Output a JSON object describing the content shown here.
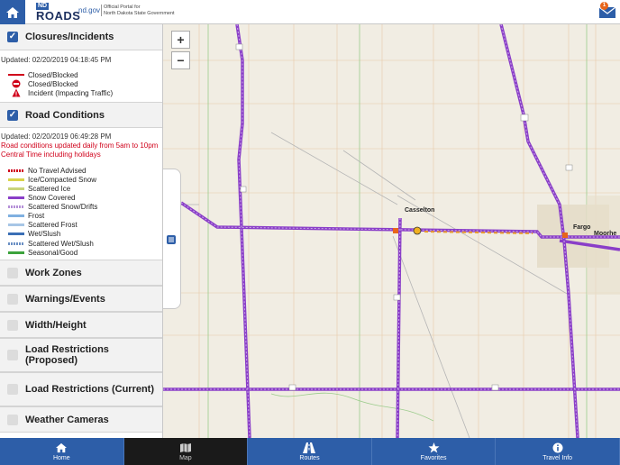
{
  "header": {
    "logo_small": "ND",
    "logo_main": "ROADS",
    "site": "nd.gov",
    "portal_line1": "Official Portal for",
    "portal_line2": "North Dakota State Government",
    "mail_count": "1"
  },
  "sidebar": {
    "closures": {
      "title": "Closures/Incidents",
      "checked": true,
      "updated": "Updated: 02/20/2019 04:18:45 PM",
      "legend": [
        {
          "label": "Closed/Blocked",
          "icon": "red-line"
        },
        {
          "label": "Closed/Blocked",
          "icon": "no-entry-icon"
        },
        {
          "label": "Incident (Impacting Traffic)",
          "icon": "warning-triangle-icon"
        }
      ]
    },
    "road_conditions": {
      "title": "Road Conditions",
      "checked": true,
      "updated": "Updated: 02/20/2019 06:49:28 PM",
      "note": "Road conditions updated daily from 5am to 10pm Central Time including holidays",
      "legend": [
        {
          "label": "No Travel Advised",
          "color": "#d0021b"
        },
        {
          "label": "Ice/Compacted Snow",
          "color": "#d9d34a"
        },
        {
          "label": "Scattered Ice",
          "color": "#c9d47a"
        },
        {
          "label": "Snow Covered",
          "color": "#8a3ec8"
        },
        {
          "label": "Scattered Snow/Drifts",
          "color": "#b58fd8"
        },
        {
          "label": "Frost",
          "color": "#7fb0e0"
        },
        {
          "label": "Scattered Frost",
          "color": "#a7c6e6"
        },
        {
          "label": "Wet/Slush",
          "color": "#3b6fb5"
        },
        {
          "label": "Scattered Wet/Slush",
          "color": "#6b8fc4"
        },
        {
          "label": "Seasonal/Good",
          "color": "#3ca33c"
        }
      ]
    },
    "layers": [
      {
        "title": "Work Zones",
        "checked": false
      },
      {
        "title": "Warnings/Events",
        "checked": false
      },
      {
        "title": "Width/Height",
        "checked": false
      },
      {
        "title": "Load Restrictions (Proposed)",
        "checked": false
      },
      {
        "title": "Load Restrictions (Current)",
        "checked": false
      },
      {
        "title": "Weather Cameras",
        "checked": false
      }
    ]
  },
  "map": {
    "zoom_in": "+",
    "zoom_out": "−",
    "cities": [
      "Casselton",
      "Fargo",
      "Moorhe"
    ],
    "road_color": "#8a3ec8"
  },
  "nav": {
    "tabs": [
      {
        "label": "Home",
        "icon": "home-icon"
      },
      {
        "label": "Map",
        "icon": "map-icon",
        "active": true
      },
      {
        "label": "Routes",
        "icon": "road-icon"
      },
      {
        "label": "Favorites",
        "icon": "star-icon"
      },
      {
        "label": "Travel Info",
        "icon": "info-icon"
      }
    ]
  }
}
